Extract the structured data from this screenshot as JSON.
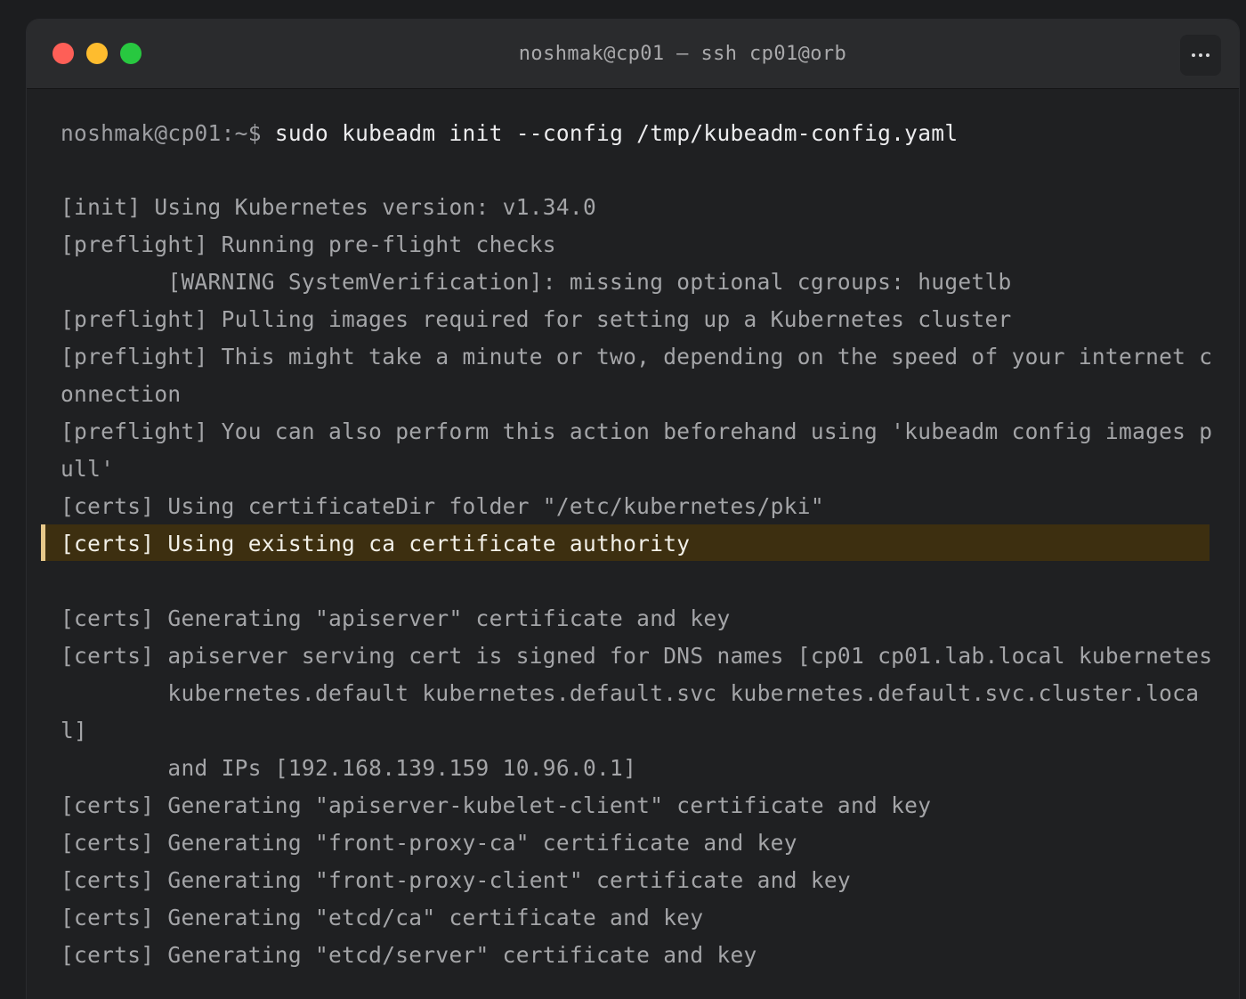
{
  "window": {
    "title": "noshmak@cp01 — ssh cp01@orb"
  },
  "colors": {
    "close": "#fe5f57",
    "minimize": "#febc2e",
    "zoom": "#28c840",
    "highlight_bg": "#3d2f10",
    "highlight_bar": "#e6c88a"
  },
  "terminal": {
    "prompt": "noshmak@cp01:~$ ",
    "command": "sudo kubeadm init --config /tmp/kubeadm-config.yaml",
    "lines": [
      "[init] Using Kubernetes version: v1.34.0",
      "[preflight] Running pre-flight checks",
      "        [WARNING SystemVerification]: missing optional cgroups: hugetlb",
      "[preflight] Pulling images required for setting up a Kubernetes cluster",
      "[preflight] This might take a minute or two, depending on the speed of your internet c",
      "onnection",
      "[preflight] You can also perform this action beforehand using 'kubeadm config images p",
      "ull'",
      "[certs] Using certificateDir folder \"/etc/kubernetes/pki\"",
      "[certs] Using existing ca certificate authority",
      "",
      "[certs] Generating \"apiserver\" certificate and key",
      "[certs] apiserver serving cert is signed for DNS names [cp01 cp01.lab.local kubernetes",
      "        kubernetes.default kubernetes.default.svc kubernetes.default.svc.cluster.loca",
      "l]",
      "        and IPs [192.168.139.159 10.96.0.1]",
      "[certs] Generating \"apiserver-kubelet-client\" certificate and key",
      "[certs] Generating \"front-proxy-ca\" certificate and key",
      "[certs] Generating \"front-proxy-client\" certificate and key",
      "[certs] Generating \"etcd/ca\" certificate and key",
      "[certs] Generating \"etcd/server\" certificate and key"
    ]
  }
}
